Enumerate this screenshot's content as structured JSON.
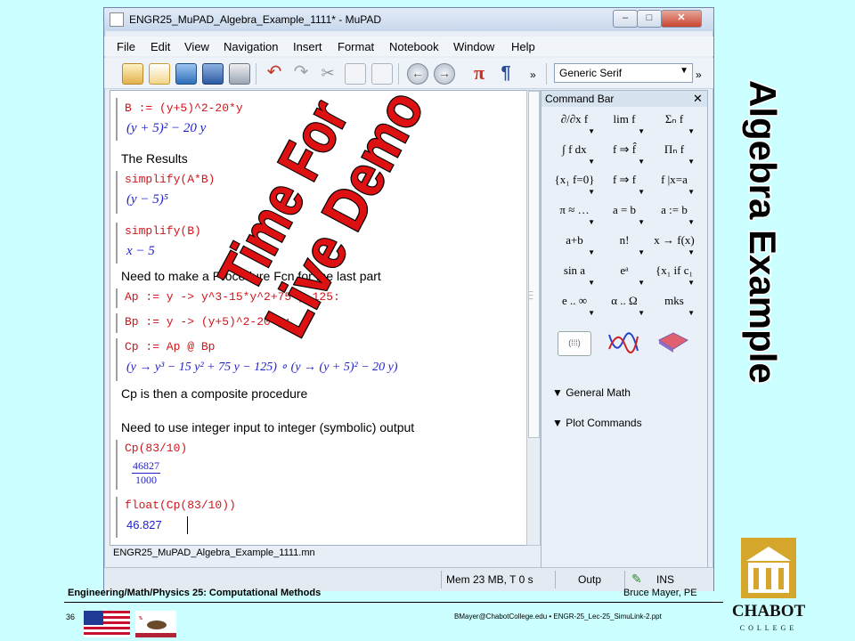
{
  "window": {
    "title": "ENGR25_MuPAD_Algebra_Example_1111* - MuPAD",
    "controls": [
      "–",
      "□",
      "✕"
    ]
  },
  "menu": [
    "File",
    "Edit",
    "View",
    "Navigation",
    "Insert",
    "Format",
    "Notebook",
    "Window",
    "Help"
  ],
  "toolbar": {
    "font_select": "Generic Serif",
    "overflow_left": "»",
    "overflow_right": "»"
  },
  "notebook": {
    "cmd_b": "B := (y+5)^2-20*y",
    "out_b": "(y + 5)² − 20 y",
    "results_heading": "The Results",
    "cmd_simplify_ab": "simplify(A*B)",
    "out_simplify_ab": "(y − 5)⁵",
    "cmd_simplify_b": "simplify(B)",
    "out_simplify_b": "x − 5",
    "procedure_text": "Need to make a Procedure Fcn for the last part",
    "cmd_ap": "Ap := y -> y^3-15*y^2+75*y-125:",
    "cmd_bp": "Bp := y -> (y+5)^2-20*y:",
    "cmd_cp": "Cp := Ap @ Bp",
    "out_cp": "(y → y³ − 15 y² + 75 y − 125) ∘ (y → (y + 5)² − 20 y)",
    "composite_text": "Cp is then a composite procedure",
    "integer_text": "Need to use integer input to integer (symbolic) output",
    "cmd_cp83": "Cp(83/10)",
    "out_cp83_num": "46827",
    "out_cp83_den": "1000",
    "cmd_float": "float(Cp(83/10))",
    "out_float": "46.827",
    "file_label": "ENGR25_MuPAD_Algebra_Example_1111.mn"
  },
  "overlay": {
    "line1": "Time For",
    "line2": "Live Demo"
  },
  "command_bar": {
    "title": "Command Bar",
    "close": "✕",
    "items": [
      "∂/∂x f",
      "lim f",
      "Σₙ f",
      "∫ f dx",
      "f ⇒ f̂",
      "Πₙ f",
      "{x₁ f=0}",
      "f ⇒ f",
      "f |x=a",
      "π ≈ …",
      "a = b",
      "a := b",
      "a+b",
      "n!",
      "x → f(x)",
      "sin a",
      "eᵃ",
      "{x₁ if c₁",
      "e .. ∞",
      "α .. Ω",
      "mks"
    ],
    "groups": [
      "General Math",
      "Plot Commands"
    ]
  },
  "status": {
    "mem": "Mem 23 MB, T 0 s",
    "outp": "Outp",
    "ins": "INS"
  },
  "slide": {
    "side_title": "Algebra Example",
    "footer_left": "Engineering/Math/Physics 25: Computational Methods",
    "footer_right": "Bruce Mayer, PE",
    "slide_number": "36",
    "footer_email": "BMayer@ChabotCollege.edu • ENGR-25_Lec-25_SimuLink-2.ppt",
    "logo_name": "CHABOT",
    "logo_sub": "COLLEGE"
  },
  "colors": {
    "background": "#ccffff",
    "command": "#d2141b",
    "output": "#1f1fcc",
    "overlay": "#dd1111"
  }
}
